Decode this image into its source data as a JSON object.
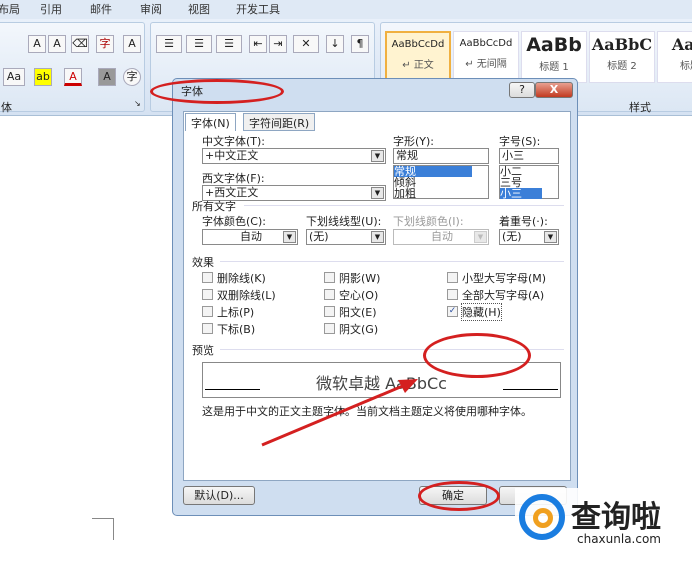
{
  "ribbon_tabs": [
    "布局",
    "引用",
    "邮件",
    "审阅",
    "视图",
    "开发工具"
  ],
  "ribbon": {
    "group_font": "体",
    "group_styles": "样式",
    "styles": [
      {
        "sample": "AaBbCcDd",
        "name": "↵ 正文"
      },
      {
        "sample": "AaBbCcDd",
        "name": "↵ 无间隔"
      },
      {
        "sample": "AaBb",
        "name": "标题 1"
      },
      {
        "sample": "AaBbC",
        "name": "标题 2"
      },
      {
        "sample": "AaB",
        "name": "标题"
      }
    ]
  },
  "dialog": {
    "title": "字体",
    "help": "?",
    "close": "X",
    "tabs": [
      "字体(N)",
      "字符间距(R)"
    ],
    "chinese_font_label": "中文字体(T):",
    "chinese_font": "+中文正文",
    "western_font_label": "西文字体(F):",
    "western_font": "+西文正文",
    "style_label": "字形(Y):",
    "style_value": "常规",
    "style_options": [
      "常规",
      "倾斜",
      "加粗"
    ],
    "size_label": "字号(S):",
    "size_value": "小三",
    "size_options": [
      "小二",
      "三号",
      "小三"
    ],
    "all_text": "所有文字",
    "font_color_label": "字体颜色(C):",
    "font_color": "自动",
    "underline_label": "下划线线型(U):",
    "underline": "(无)",
    "underline_color_label": "下划线颜色(I):",
    "underline_color": "自动",
    "emphasis_label": "着重号(·):",
    "emphasis": "(无)",
    "effects": "效果",
    "checkboxes": [
      {
        "label": "删除线(K)",
        "checked": false
      },
      {
        "label": "双删除线(L)",
        "checked": false
      },
      {
        "label": "上标(P)",
        "checked": false
      },
      {
        "label": "下标(B)",
        "checked": false
      },
      {
        "label": "阴影(W)",
        "checked": false
      },
      {
        "label": "空心(O)",
        "checked": false
      },
      {
        "label": "阳文(E)",
        "checked": false
      },
      {
        "label": "阴文(G)",
        "checked": false
      },
      {
        "label": "小型大写字母(M)",
        "checked": false
      },
      {
        "label": "全部大写字母(A)",
        "checked": false
      },
      {
        "label": "隐藏(H)",
        "checked": true
      }
    ],
    "preview": "预览",
    "preview_text": "微软卓越 AaBbCc",
    "description": "这是用于中文的正文主题字体。当前文档主题定义将使用哪种字体。",
    "default_button": "默认(D)...",
    "ok_button": "确定"
  },
  "watermark": {
    "text": "查询啦",
    "url": "chaxunla.com"
  },
  "colors": {
    "annotation": "#d42020",
    "accent": "#3b7fd8"
  }
}
